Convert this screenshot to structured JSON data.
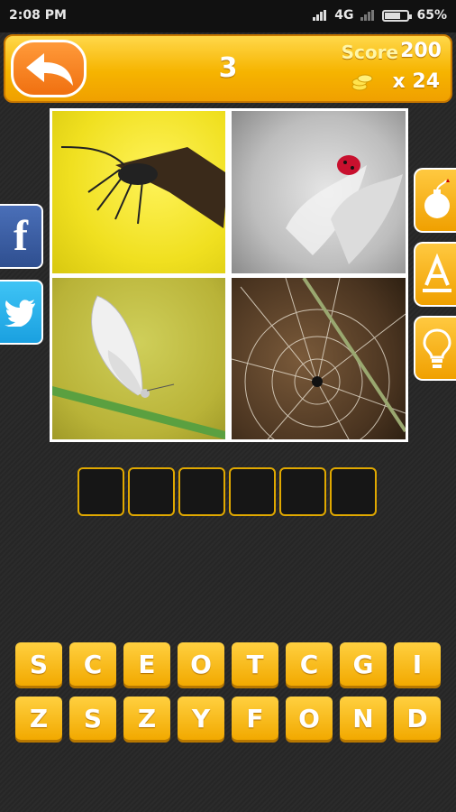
{
  "status_bar": {
    "time": "2:08 PM",
    "network": "4G",
    "battery": "65%"
  },
  "header": {
    "level": "3",
    "score_label": "Score",
    "score_value": "200",
    "coins_text": "x 24"
  },
  "answer": {
    "slot_count": 6
  },
  "letters": [
    "S",
    "C",
    "E",
    "O",
    "T",
    "C",
    "G",
    "I",
    "Z",
    "S",
    "Z",
    "Y",
    "F",
    "O",
    "N",
    "D"
  ],
  "icons": {
    "back": "back-arrow-icon",
    "coins": "coins-icon",
    "bomb": "bomb-icon",
    "reveal_letter": "letter-a-icon",
    "hint": "lightbulb-icon",
    "facebook": "facebook-icon",
    "twitter": "twitter-icon"
  },
  "colors": {
    "accent": "#f6b400",
    "back_button": "#f07010",
    "facebook": "#3b5998",
    "twitter": "#1da1f2"
  }
}
